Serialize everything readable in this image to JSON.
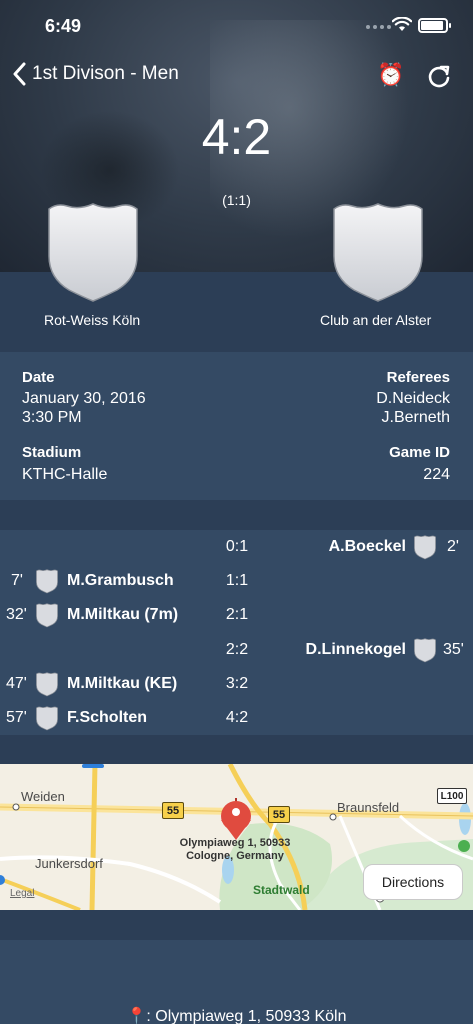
{
  "status_bar": {
    "time": "6:49"
  },
  "nav": {
    "back_label": "1st Divison - Men",
    "alarm_icon": "⏰"
  },
  "match": {
    "score": "4:2",
    "halftime": "(1:1)",
    "home_team": "Rot-Weiss Köln",
    "away_team": "Club an der Alster"
  },
  "details": {
    "date_label": "Date",
    "date_value": "January 30, 2016",
    "time_value": "3:30 PM",
    "referees_label": "Referees",
    "referee_1": "D.Neideck",
    "referee_2": "J.Berneth",
    "stadium_label": "Stadium",
    "stadium_value": "KTHC-Halle",
    "game_id_label": "Game ID",
    "game_id_value": "224"
  },
  "goals": [
    {
      "side": "away",
      "minute": "2'",
      "player": "A.Boeckel",
      "score": "0:1"
    },
    {
      "side": "home",
      "minute": "7'",
      "player": "M.Grambusch",
      "score": "1:1"
    },
    {
      "side": "home",
      "minute": "32'",
      "player": "M.Miltkau (7m)",
      "score": "2:1"
    },
    {
      "side": "away",
      "minute": "35'",
      "player": "D.Linnekogel",
      "score": "2:2"
    },
    {
      "side": "home",
      "minute": "47'",
      "player": "M.Miltkau (KE)",
      "score": "3:2"
    },
    {
      "side": "home",
      "minute": "57'",
      "player": "F.Scholten",
      "score": "4:2"
    }
  ],
  "map": {
    "labels": {
      "weiden": "Weiden",
      "junkersdorf": "Junkersdorf",
      "braunsfeld": "Braunsfeld",
      "stadtwald": "Stadtwald"
    },
    "road_55_a": "55",
    "road_55_b": "55",
    "road_l100": "L100",
    "address_line1": "Olympiaweg 1, 50933",
    "address_line2": "Cologne, Germany",
    "directions_label": "Directions",
    "legal_label": "Legal",
    "accent_color": "#e04b3f"
  },
  "footer": {
    "address": "📍: Olympiaweg 1, 50933 Köln"
  },
  "colors": {
    "background": "#2c3e56",
    "panel": "#344a64"
  }
}
